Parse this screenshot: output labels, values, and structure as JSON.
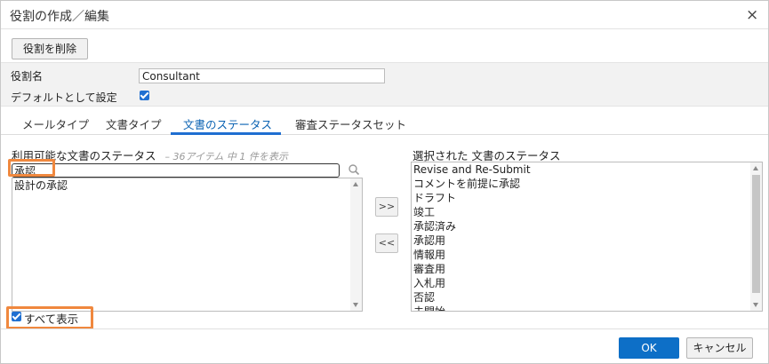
{
  "dialog": {
    "title": "役割の作成／編集",
    "close_symbol": "×"
  },
  "toolbar": {
    "delete_label": "役割を削除"
  },
  "properties": {
    "role_name_label": "役割名",
    "role_name_value": "Consultant",
    "default_label": "デフォルトとして設定",
    "default_checked": true
  },
  "tabs": [
    {
      "label": "メールタイプ",
      "active": false
    },
    {
      "label": "文書タイプ",
      "active": false
    },
    {
      "label": "文書のステータス",
      "active": true
    },
    {
      "label": "審査ステータスセット",
      "active": false
    }
  ],
  "available": {
    "header": "利用可能な文書のステータス",
    "count_text": "– 36アイテム 中 1 件を表示",
    "filter_value": "承認",
    "items": [
      "設計の承認"
    ]
  },
  "move_buttons": {
    "add_label": ">>",
    "remove_label": "<<"
  },
  "selected": {
    "header": "選択された 文書のステータス",
    "items": [
      "Revise and Re-Submit",
      "コメントを前提に承認",
      "ドラフト",
      "竣工",
      "承認済み",
      "承認用",
      "情報用",
      "審査用",
      "入札用",
      "否認",
      "未開始"
    ]
  },
  "show_all": {
    "label": "すべて表示",
    "checked": true
  },
  "footer": {
    "ok_label": "OK",
    "cancel_label": "キャンセル"
  },
  "colors": {
    "accent": "#1f6fd1",
    "primary_button": "#0d6fc7",
    "highlight": "#f0883e"
  }
}
